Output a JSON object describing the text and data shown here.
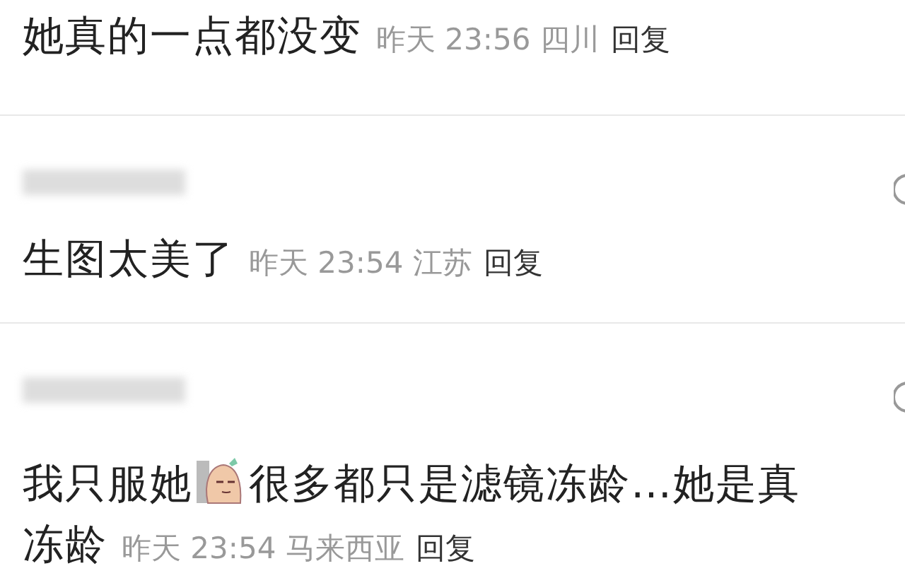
{
  "comments": [
    {
      "username_blurred": false,
      "like_icon": false,
      "segments": [
        {
          "kind": "text",
          "text": "她真的一点都没变"
        }
      ],
      "time": "昨天 23:56",
      "location": "四川",
      "reply": "回复"
    },
    {
      "username_blurred": true,
      "like_icon": true,
      "segments": [
        {
          "kind": "text",
          "text": "生图太美了"
        }
      ],
      "time": "昨天 23:54",
      "location": "江苏",
      "reply": "回复"
    },
    {
      "username_blurred": true,
      "like_icon": true,
      "segments": [
        {
          "kind": "text",
          "text": "我只服她"
        },
        {
          "kind": "sticker"
        },
        {
          "kind": "text",
          "text": "很多都只是滤镜冻龄…她是真冻龄"
        }
      ],
      "time": "昨天 23:54",
      "location": "马来西亚",
      "reply": "回复"
    }
  ]
}
